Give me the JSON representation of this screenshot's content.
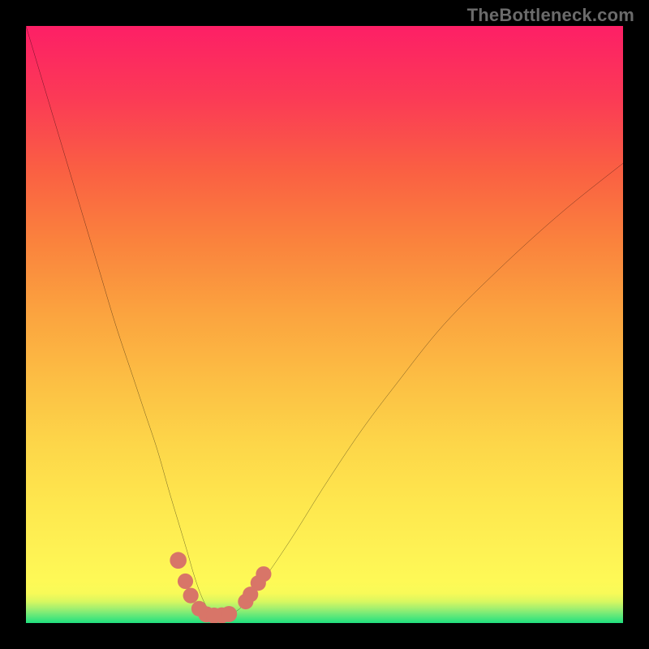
{
  "watermark": {
    "text": "TheBottleneck.com"
  },
  "colors": {
    "frame": "#000000",
    "curve": "#000000",
    "marker": "#d87568",
    "gradient_top": "#fd1f66",
    "gradient_mid": "#fdd649",
    "gradient_bottom": "#1fe07e"
  },
  "chart_data": {
    "type": "line",
    "title": "",
    "xlabel": "",
    "ylabel": "",
    "xlim": [
      0,
      100
    ],
    "ylim": [
      0,
      100
    ],
    "grid": false,
    "legend": false,
    "series": [
      {
        "name": "bottleneck-curve",
        "x": [
          0,
          3,
          6,
          9,
          12,
          15,
          18,
          20,
          22,
          24,
          25.5,
          27,
          28,
          29,
          30,
          31,
          32,
          33,
          34.5,
          36,
          38,
          41,
          45,
          50,
          56,
          62,
          70,
          80,
          90,
          100
        ],
        "y": [
          100,
          90,
          80,
          70,
          60,
          50,
          41,
          35,
          29,
          22,
          17,
          12,
          8.5,
          5.5,
          3.2,
          1.8,
          1.2,
          1.2,
          1.6,
          2.6,
          5,
          9,
          15,
          23,
          32,
          40,
          50,
          60,
          69,
          77
        ]
      }
    ],
    "markers": [
      {
        "x": 25.5,
        "y": 10.5,
        "r": 1.4
      },
      {
        "x": 26.7,
        "y": 7.0,
        "r": 1.3
      },
      {
        "x": 27.6,
        "y": 4.6,
        "r": 1.3
      },
      {
        "x": 29.0,
        "y": 2.4,
        "r": 1.3
      },
      {
        "x": 30.2,
        "y": 1.45,
        "r": 1.35
      },
      {
        "x": 31.5,
        "y": 1.25,
        "r": 1.35
      },
      {
        "x": 32.8,
        "y": 1.28,
        "r": 1.35
      },
      {
        "x": 34.0,
        "y": 1.5,
        "r": 1.35
      },
      {
        "x": 36.8,
        "y": 3.6,
        "r": 1.3
      },
      {
        "x": 37.6,
        "y": 4.8,
        "r": 1.3
      },
      {
        "x": 38.9,
        "y": 6.7,
        "r": 1.3
      },
      {
        "x": 39.8,
        "y": 8.2,
        "r": 1.3
      }
    ]
  }
}
